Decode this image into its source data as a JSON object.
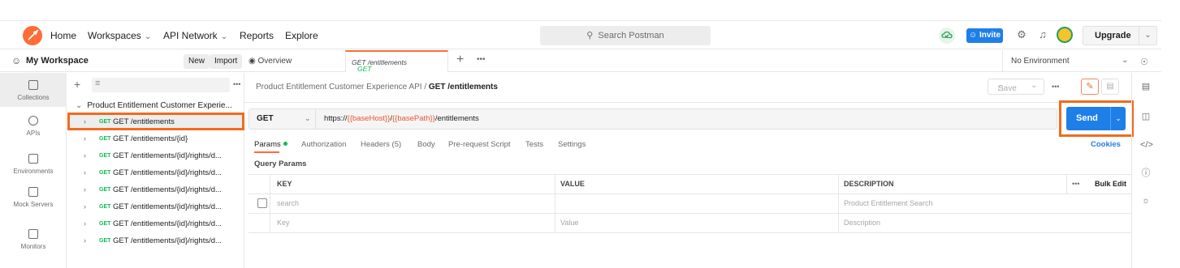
{
  "topbar": {
    "nav": [
      {
        "label": "Home"
      },
      {
        "label": "Workspaces",
        "dropdown": true
      },
      {
        "label": "API Network",
        "dropdown": true
      },
      {
        "label": "Reports"
      },
      {
        "label": "Explore"
      }
    ],
    "search_placeholder": "Search Postman",
    "invite_label": "Invite",
    "upgrade_label": "Upgrade",
    "brand_color": "#ff6c37"
  },
  "workspace": {
    "title": "My Workspace",
    "new_label": "New",
    "import_label": "Import"
  },
  "tabs": {
    "overview_label": "Overview",
    "active_method": "GET",
    "active_label": "GET /entitlements",
    "environment": "No Environment"
  },
  "rail": [
    {
      "label": "Collections",
      "icon": "collections-icon",
      "active": true
    },
    {
      "label": "APIs",
      "icon": "apis-icon"
    },
    {
      "label": "Environments",
      "icon": "environments-icon"
    },
    {
      "label": "Mock Servers",
      "icon": "mock-servers-icon"
    },
    {
      "label": "Monitors",
      "icon": "monitors-icon"
    }
  ],
  "tree": {
    "collection": "Product Entitlement Customer Experie...",
    "items": [
      {
        "method": "GET",
        "label": "GET /entitlements",
        "selected": true
      },
      {
        "method": "GET",
        "label": "GET /entitlements/{id}"
      },
      {
        "method": "GET",
        "label": "GET /entitlements/{id}/rights/d..."
      },
      {
        "method": "GET",
        "label": "GET /entitlements/{id}/rights/d..."
      },
      {
        "method": "GET",
        "label": "GET /entitlements/{id}/rights/d..."
      },
      {
        "method": "GET",
        "label": "GET /entitlements/{id}/rights/d..."
      },
      {
        "method": "GET",
        "label": "GET /entitlements/{id}/rights/d..."
      },
      {
        "method": "GET",
        "label": "GET /entitlements/{id}/rights/d..."
      }
    ]
  },
  "request": {
    "breadcrumb_parent": "Product Entitlement Customer Experience API",
    "breadcrumb_sep": "/",
    "breadcrumb_current": "GET /entitlements",
    "save_label": "Save",
    "method": "GET",
    "url_prefix": "https://",
    "url_var1": "{{baseHost}}",
    "url_slash": "/",
    "url_var2": "{{basePath}}",
    "url_suffix": "/entitlements",
    "send_label": "Send",
    "tabs": [
      "Params",
      "Authorization",
      "Headers (5)",
      "Body",
      "Pre-request Script",
      "Tests",
      "Settings"
    ],
    "cookies_label": "Cookies",
    "query_params_title": "Query Params",
    "table": {
      "headers": {
        "key": "KEY",
        "value": "VALUE",
        "description": "DESCRIPTION",
        "bulk_edit": "Bulk Edit"
      },
      "rows": [
        {
          "key": "search",
          "value": "",
          "description": "Product Entitlement Search"
        }
      ],
      "placeholder": {
        "key": "Key",
        "value": "Value",
        "description": "Description"
      }
    }
  }
}
